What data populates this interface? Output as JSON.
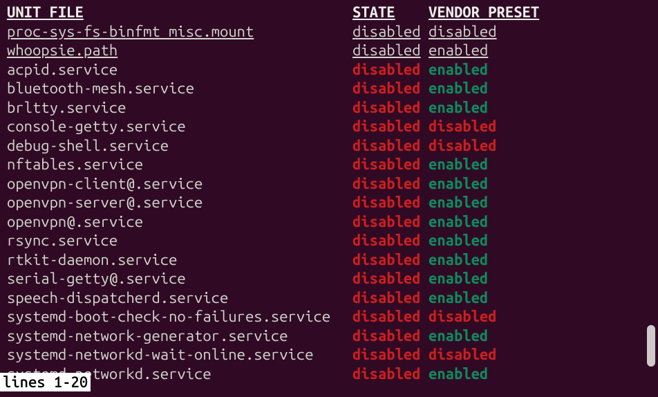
{
  "headers": {
    "unit": "UNIT FILE",
    "state": "STATE",
    "preset": "VENDOR PRESET"
  },
  "rows": [
    {
      "unit": "proc-sys-fs-binfmt_misc.mount",
      "state": "disabled",
      "preset": "disabled",
      "style": "underline"
    },
    {
      "unit": "whoopsie.path",
      "state": "disabled",
      "preset": "enabled",
      "style": "underline"
    },
    {
      "unit": "acpid.service",
      "state": "disabled",
      "preset": "enabled",
      "style": "color"
    },
    {
      "unit": "bluetooth-mesh.service",
      "state": "disabled",
      "preset": "enabled",
      "style": "color"
    },
    {
      "unit": "brltty.service",
      "state": "disabled",
      "preset": "enabled",
      "style": "color"
    },
    {
      "unit": "console-getty.service",
      "state": "disabled",
      "preset": "disabled",
      "style": "color"
    },
    {
      "unit": "debug-shell.service",
      "state": "disabled",
      "preset": "disabled",
      "style": "color"
    },
    {
      "unit": "nftables.service",
      "state": "disabled",
      "preset": "enabled",
      "style": "color"
    },
    {
      "unit": "openvpn-client@.service",
      "state": "disabled",
      "preset": "enabled",
      "style": "color"
    },
    {
      "unit": "openvpn-server@.service",
      "state": "disabled",
      "preset": "enabled",
      "style": "color"
    },
    {
      "unit": "openvpn@.service",
      "state": "disabled",
      "preset": "enabled",
      "style": "color"
    },
    {
      "unit": "rsync.service",
      "state": "disabled",
      "preset": "enabled",
      "style": "color"
    },
    {
      "unit": "rtkit-daemon.service",
      "state": "disabled",
      "preset": "enabled",
      "style": "color"
    },
    {
      "unit": "serial-getty@.service",
      "state": "disabled",
      "preset": "enabled",
      "style": "color"
    },
    {
      "unit": "speech-dispatcherd.service",
      "state": "disabled",
      "preset": "enabled",
      "style": "color"
    },
    {
      "unit": "systemd-boot-check-no-failures.service",
      "state": "disabled",
      "preset": "disabled",
      "style": "color"
    },
    {
      "unit": "systemd-network-generator.service",
      "state": "disabled",
      "preset": "enabled",
      "style": "color"
    },
    {
      "unit": "systemd-networkd-wait-online.service",
      "state": "disabled",
      "preset": "disabled",
      "style": "color"
    },
    {
      "unit": "systemd-networkd.service",
      "state": "disabled",
      "preset": "enabled",
      "style": "color"
    }
  ],
  "pager": "lines 1-20"
}
